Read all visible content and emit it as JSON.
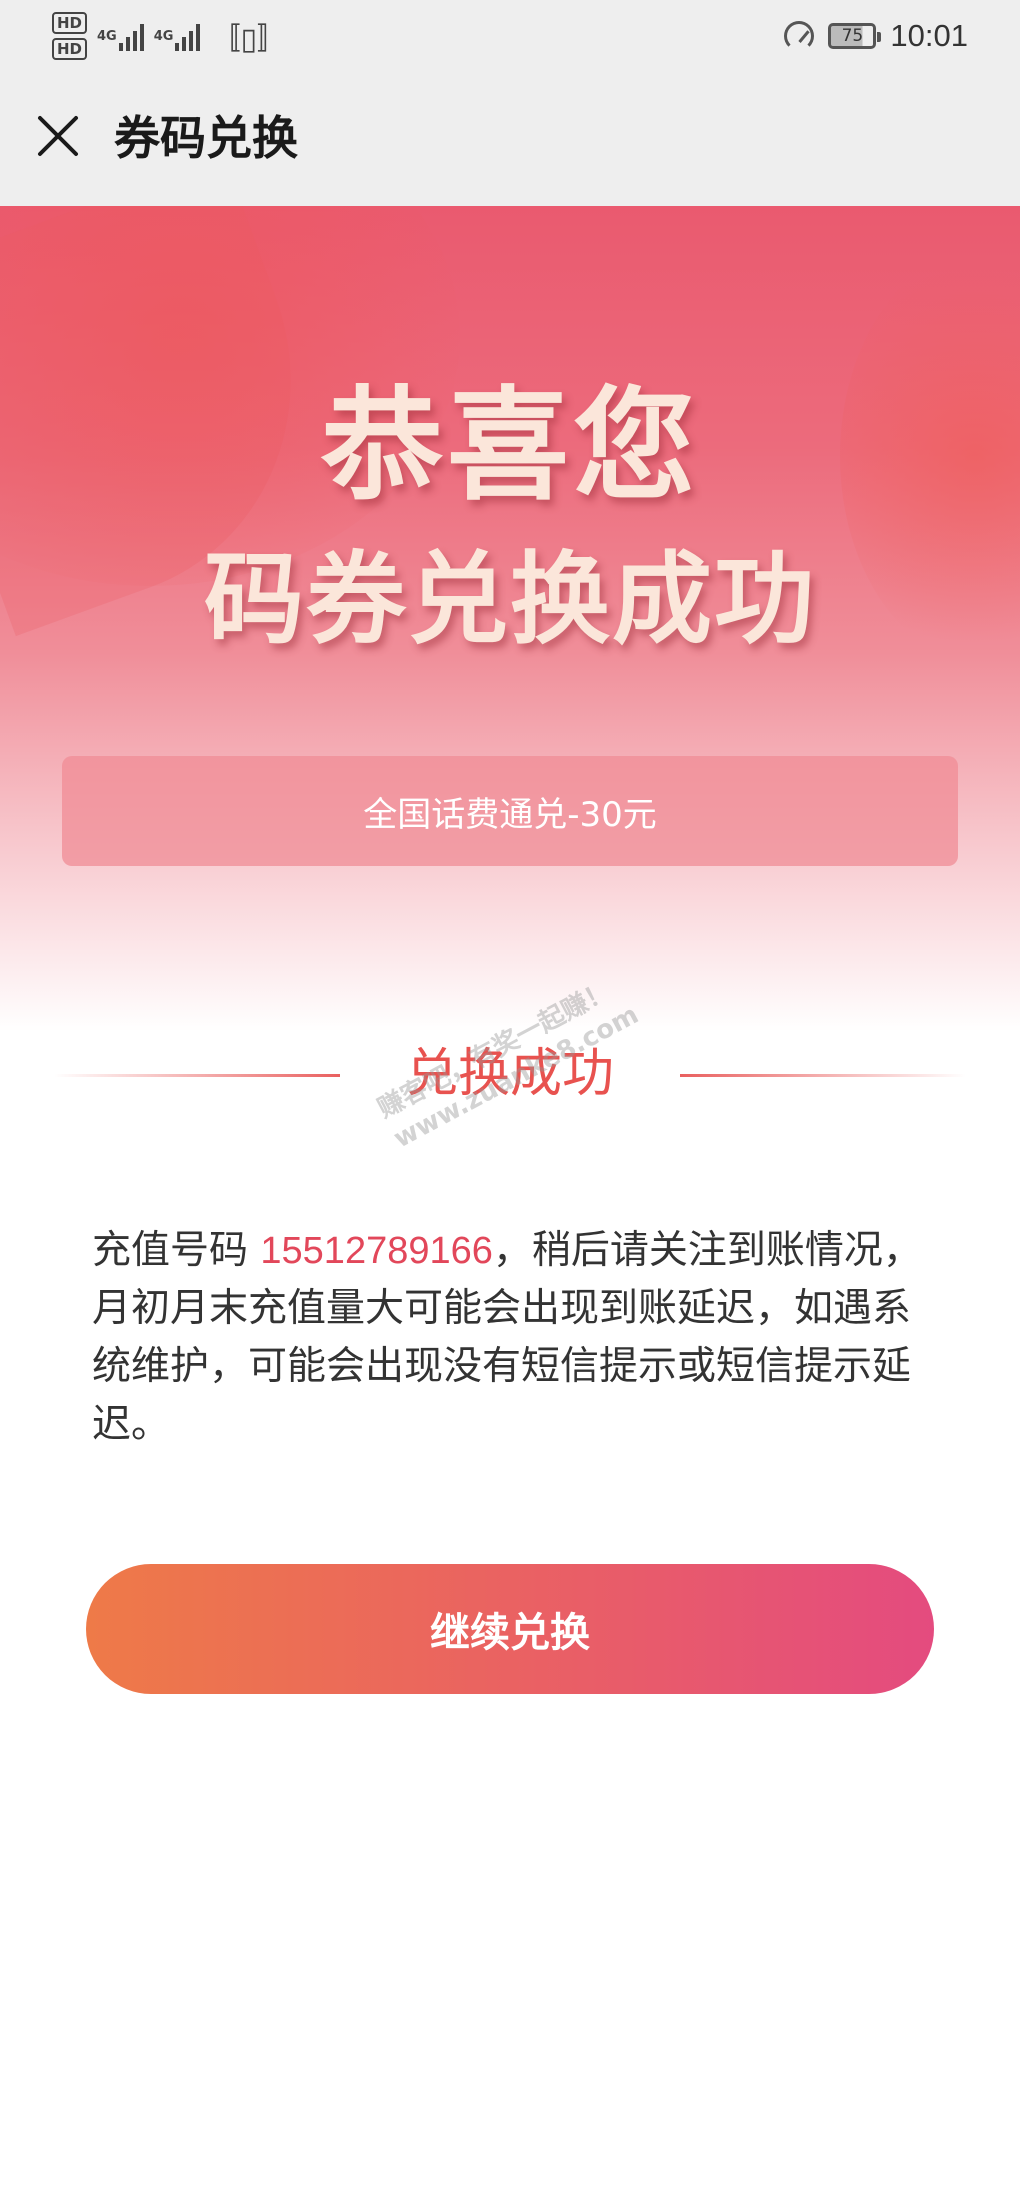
{
  "status_bar": {
    "sim1_label": "HD",
    "sim2_label": "HD",
    "net1_label": "4G",
    "net2_label": "4G",
    "battery_level": "75",
    "time": "10:01"
  },
  "nav": {
    "title": "券码兑换"
  },
  "hero": {
    "headline_line1": "恭喜您",
    "headline_line2": "码券兑换成功",
    "coupon_name": "全国话费通兑-30元"
  },
  "result": {
    "section_title": "兑换成功",
    "message_prefix": "充值号码 ",
    "phone_number": "15512789166",
    "message_suffix": "，稍后请关注到账情况，月初月末充值量大可能会出现到账延迟，如遇系统维护，可能会出现没有短信提示或短信提示延迟。"
  },
  "actions": {
    "continue_label": "继续兑换"
  },
  "watermark": {
    "line1": "赚客吧，有奖一起赚！",
    "line2": "www.zuanke8.com"
  },
  "colors": {
    "accent_red": "#e8524f",
    "phone_color": "#e2475a",
    "button_start": "#ee7a48",
    "button_end": "#e44b7f"
  }
}
